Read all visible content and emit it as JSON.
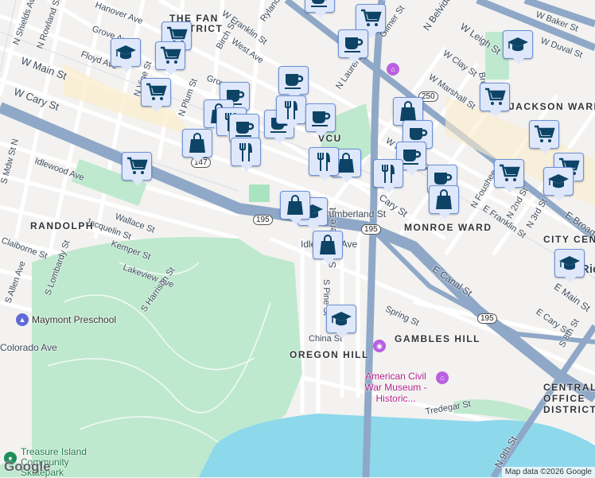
{
  "colors": {
    "water": "#8ed8ec",
    "park": "#bfe9cf",
    "highway": "#8fa8c8",
    "road": "#ffffff",
    "pin_bg": "#dfe8fb",
    "pin_icon": "#0d4466"
  },
  "neighborhoods": [
    "THE FAN DISTRICT",
    "RANDOLPH",
    "VCU",
    "JACKSON WARD",
    "MONROE WARD",
    "OREGON HILL",
    "GAMBLES HILL",
    "CITY CENTER",
    "CENTRAL OFFICE DISTRICT"
  ],
  "streets": [
    "Hanover Ave",
    "Grove Ave",
    "Floyd Ave",
    "W Main St",
    "W Cary St",
    "Idlewood Ave",
    "N Shields Ave",
    "N Rowland St",
    "N Vine St",
    "N Plum St",
    "Birch St",
    "West Ave",
    "W Franklin St",
    "Ryland St",
    "Wallace St",
    "Jacquelin St",
    "Kemper St",
    "Claiborne St",
    "Lakeview Ave",
    "S Harrison St",
    "S Allen Ave",
    "S Lombardy St",
    "Colorado Ave",
    "S Mdw St N",
    "Gilmer St",
    "N Laurel St",
    "N Belvidere St",
    "W Leigh St",
    "W Baker St",
    "W Duval St",
    "W Clay St",
    "W Marshall St",
    "Brook Rd",
    "W Franklin St",
    "Cary St",
    "N Foushee St",
    "E Franklin St",
    "N 2nd St",
    "N 3rd St",
    "E Broad St",
    "E Canal St",
    "E Main St",
    "E Cary St",
    "S 8th St",
    "Spring St",
    "China St",
    "S Pine St",
    "S Belvidere St",
    "Tredegar St",
    "N 9th St",
    "Cumberland St",
    "Idlewood Ave",
    "Grove Ave",
    "Rich"
  ],
  "pois": [
    "Maymont Preschool",
    "American Civil War Museum - Historic...",
    "Treasure Island Community Skatepark"
  ],
  "routes": [
    "195",
    "195",
    "195",
    "147",
    "250"
  ],
  "markers": [
    "cart",
    "cart",
    "grad",
    "cart",
    "coffee",
    "bag",
    "food",
    "coffee",
    "coffee",
    "bag",
    "food",
    "cart",
    "coffee",
    "food",
    "cart",
    "coffee",
    "grad",
    "cart",
    "bag",
    "coffee",
    "coffee",
    "food",
    "bag",
    "food",
    "coffee",
    "cart",
    "cart",
    "grad",
    "cart",
    "coffee",
    "bag",
    "grad",
    "bag",
    "bag",
    "grad",
    "grad",
    "coffee"
  ],
  "footer": {
    "google": "Google",
    "attribution": "Map data ©2026 Google"
  }
}
